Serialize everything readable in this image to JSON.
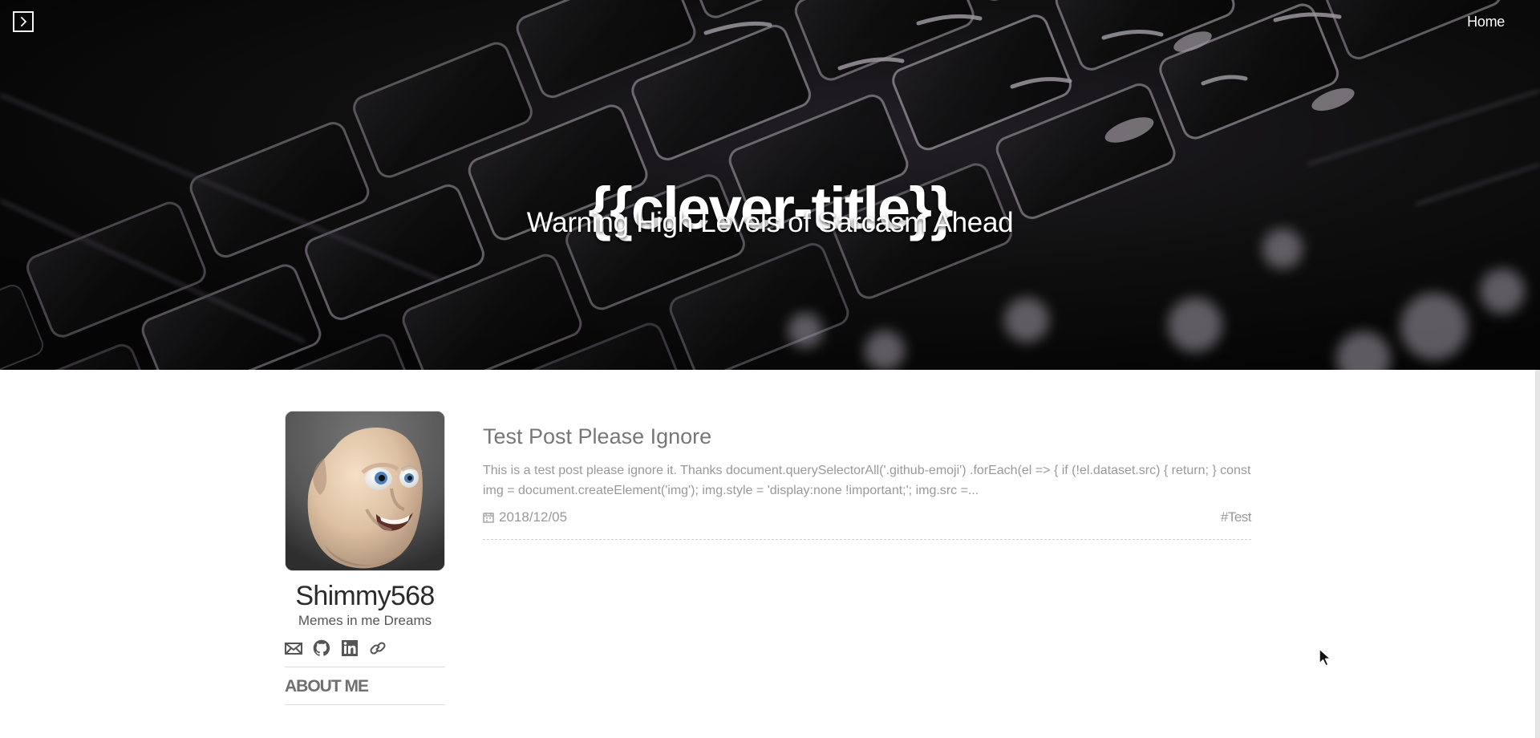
{
  "header": {
    "home_label": "Home",
    "title": "{{clever-title}}",
    "subtitle": "Warning High Levels of Sarcasm Ahead"
  },
  "profile": {
    "name": "Shimmy568",
    "bio": "Memes in me Dreams",
    "about_label": "ABOUT ME",
    "social_icons": [
      "mail-icon",
      "github-icon",
      "linkedin-icon",
      "link-icon"
    ]
  },
  "post": {
    "title": "Test Post Please Ignore",
    "excerpt": "This is a test post please ignore it. Thanks document.querySelectorAll('.github-emoji') .forEach(el => { if (!el.dataset.src) { return; } const img = document.createElement('img'); img.style = 'display:none !important;'; img.src =...",
    "date": "2018/12/05",
    "tag": "#Test"
  },
  "colors": {
    "hero_background": "#111111",
    "hero_text": "#ffffff",
    "body_background": "#ffffff",
    "post_title": "#777777",
    "muted_text": "#999999"
  },
  "icons": {
    "sidebar_toggle": "chevron-right-icon",
    "date": "calendar-icon"
  }
}
